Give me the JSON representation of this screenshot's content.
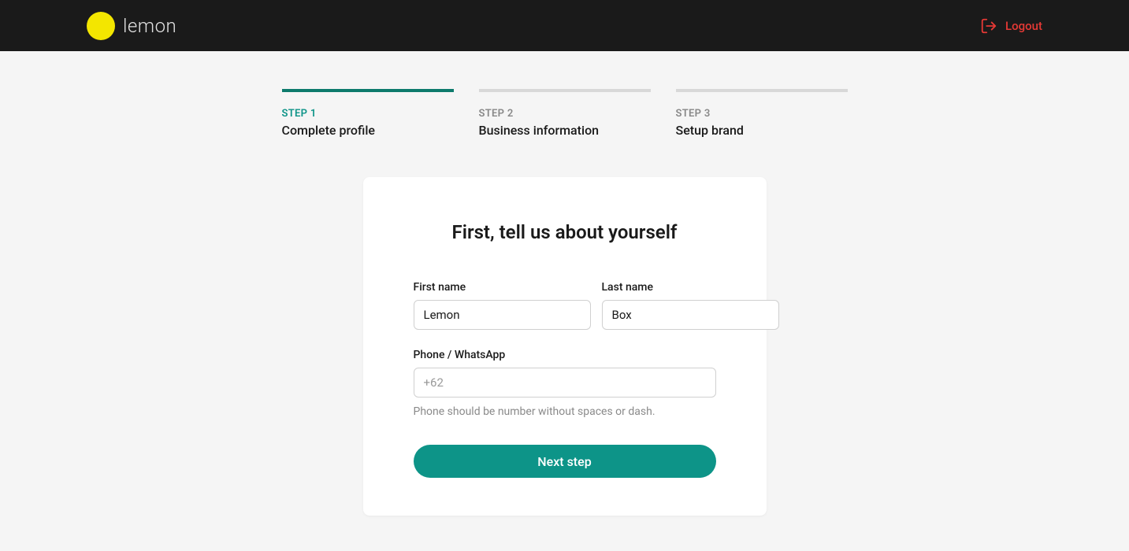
{
  "header": {
    "brand_name": "lemon",
    "logout_label": "Logout"
  },
  "steps": [
    {
      "label": "STEP 1",
      "title": "Complete profile",
      "active": true
    },
    {
      "label": "STEP 2",
      "title": "Business information",
      "active": false
    },
    {
      "label": "STEP 3",
      "title": "Setup brand",
      "active": false
    }
  ],
  "form": {
    "heading": "First, tell us about yourself",
    "first_name": {
      "label": "First name",
      "value": "Lemon"
    },
    "last_name": {
      "label": "Last name",
      "value": "Box"
    },
    "phone": {
      "label": "Phone / WhatsApp",
      "placeholder": "+62",
      "hint": "Phone should be number without spaces or dash."
    },
    "submit_label": "Next step"
  }
}
